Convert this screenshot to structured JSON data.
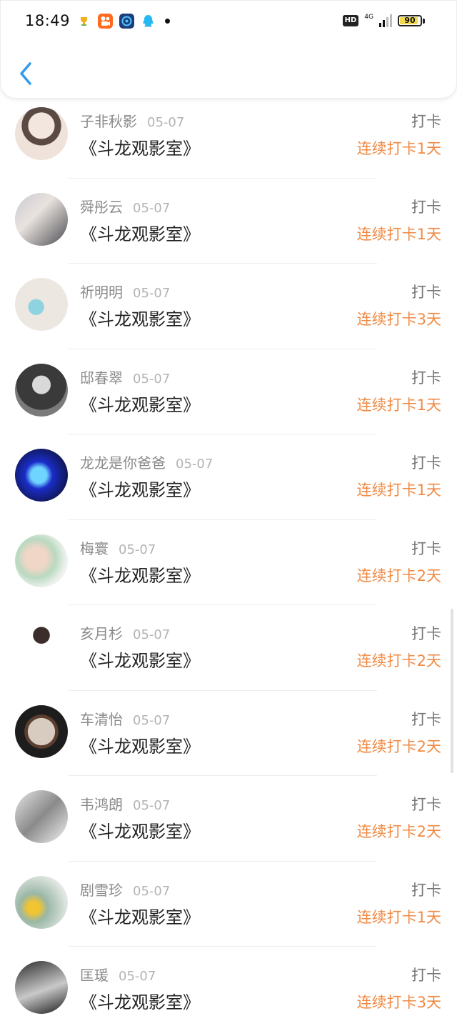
{
  "status_bar": {
    "time": "18:49",
    "hd": "HD",
    "network": "4G",
    "battery": "90",
    "battery_level": 0.9
  },
  "header": {
    "back_icon": "chevron-left-icon",
    "accent_color": "#2f9bf0"
  },
  "colors": {
    "streak": "#f08a44",
    "name": "#8a8a8a",
    "date": "#b3b3b3"
  },
  "entries": [
    {
      "name": "子非秋影",
      "date": "05-07",
      "title": "《斗龙观影室》",
      "action": "打卡",
      "streak": "连续打卡1天"
    },
    {
      "name": "舜彤云",
      "date": "05-07",
      "title": "《斗龙观影室》",
      "action": "打卡",
      "streak": "连续打卡1天"
    },
    {
      "name": "祈明明",
      "date": "05-07",
      "title": "《斗龙观影室》",
      "action": "打卡",
      "streak": "连续打卡3天"
    },
    {
      "name": "邸春翠",
      "date": "05-07",
      "title": "《斗龙观影室》",
      "action": "打卡",
      "streak": "连续打卡1天"
    },
    {
      "name": "龙龙是你爸爸",
      "date": "05-07",
      "title": "《斗龙观影室》",
      "action": "打卡",
      "streak": "连续打卡1天"
    },
    {
      "name": "梅寰",
      "date": "05-07",
      "title": "《斗龙观影室》",
      "action": "打卡",
      "streak": "连续打卡2天"
    },
    {
      "name": "亥月杉",
      "date": "05-07",
      "title": "《斗龙观影室》",
      "action": "打卡",
      "streak": "连续打卡2天"
    },
    {
      "name": "车清怡",
      "date": "05-07",
      "title": "《斗龙观影室》",
      "action": "打卡",
      "streak": "连续打卡2天"
    },
    {
      "name": "韦鸿朗",
      "date": "05-07",
      "title": "《斗龙观影室》",
      "action": "打卡",
      "streak": "连续打卡2天"
    },
    {
      "name": "剧雪珍",
      "date": "05-07",
      "title": "《斗龙观影室》",
      "action": "打卡",
      "streak": "连续打卡1天"
    },
    {
      "name": "匡瑗",
      "date": "05-07",
      "title": "《斗龙观影室》",
      "action": "打卡",
      "streak": "连续打卡3天"
    }
  ]
}
